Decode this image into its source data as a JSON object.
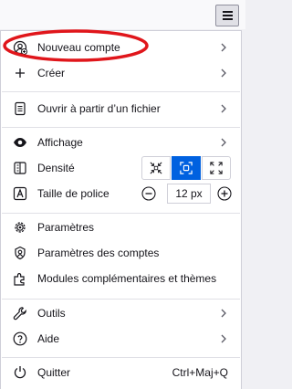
{
  "menu": {
    "new_account": "Nouveau compte",
    "create": "Créer",
    "open_file": "Ouvrir à partir d’un fichier",
    "view": "Affichage",
    "density": "Densité",
    "font_size": "Taille de police",
    "font_size_value": "12 px",
    "settings": "Paramètres",
    "account_settings": "Paramètres des comptes",
    "addons": "Modules complémentaires et thèmes",
    "tools": "Outils",
    "help": "Aide",
    "quit": "Quitter",
    "quit_shortcut": "Ctrl+Maj+Q"
  },
  "density_options": [
    "compact",
    "normal",
    "touch"
  ],
  "density_selected": "normal",
  "colors": {
    "accent": "#0061e0",
    "highlight_ring": "#e0161b"
  },
  "icons": [
    "menu-icon",
    "new-account-icon",
    "plus-icon",
    "file-icon",
    "eye-icon",
    "density-icon",
    "font-size-icon",
    "gear-icon",
    "account-settings-icon",
    "addons-icon",
    "wrench-icon",
    "help-icon",
    "power-icon",
    "chevron-right-icon"
  ]
}
